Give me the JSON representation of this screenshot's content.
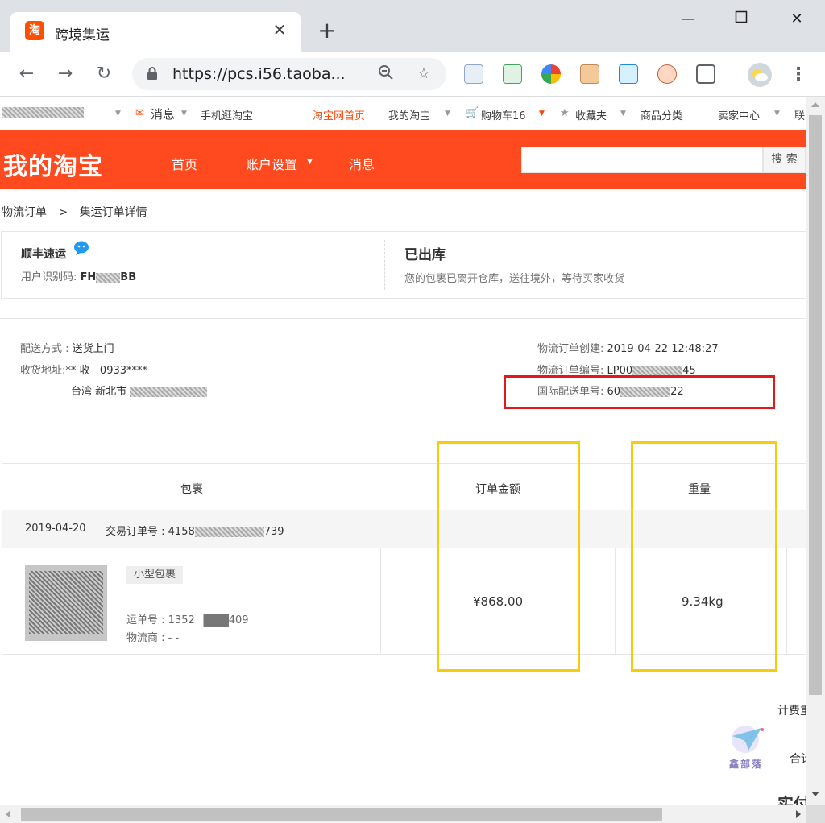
{
  "browser": {
    "tab_title": "跨境集运",
    "tab_favicon": "淘",
    "url": "https://pcs.i56.taoba...",
    "colors": {
      "chrome_bg": "#dee1e6",
      "tab_bg": "#ffffff"
    },
    "icons": [
      "back-icon",
      "forward-icon",
      "reload-icon",
      "lock-icon",
      "zoom-icon",
      "star-icon",
      "profile-avatar-icon",
      "menu-icon"
    ]
  },
  "site_bar": {
    "message": "消息",
    "mobile": "手机逛淘宝",
    "home": "淘宝网首页",
    "my_taobao": "我的淘宝",
    "cart": "购物车16",
    "favorites": "收藏夹",
    "categories": "商品分类",
    "seller": "卖家中心",
    "more": "联"
  },
  "header": {
    "brand": "我的淘宝",
    "nav": [
      "首页",
      "账户设置",
      "消息"
    ],
    "search_button": "搜 索",
    "brand_color": "#ff4a1f"
  },
  "breadcrumb": {
    "root": "物流订单",
    "sep": ">",
    "current": "集运订单详情"
  },
  "status_panel": {
    "carrier": "顺丰速运",
    "user_code_label": "用户识别码:",
    "user_code_prefix": "FH",
    "user_code_suffix": "BB",
    "status": "已出库",
    "status_desc": "您的包裹已离开仓库，送往境外，等待买家收货"
  },
  "info": {
    "delivery_label": "配送方式 :",
    "delivery_value": "送货上门",
    "address_label": "收货地址:",
    "address_line1": "** 收   0933****",
    "address_line2": "台湾 新北市",
    "created_label": "物流订单创建:",
    "created_value": "2019-04-22 12:48:27",
    "order_no_label": "物流订单编号:",
    "order_no_prefix": "LP00",
    "order_no_suffix": "45",
    "intl_no_label": "国际配送单号:",
    "intl_no_prefix": "60",
    "intl_no_suffix": "22"
  },
  "table": {
    "headers": {
      "package": "包裹",
      "amount": "订单金额",
      "weight": "重量"
    },
    "order_date": "2019-04-20",
    "trade_label": "交易订单号 :",
    "trade_prefix": "4158",
    "trade_suffix": "739",
    "item": {
      "tag": "小型包裹",
      "waybill_label": "运单号 :",
      "waybill_prefix": "1352",
      "waybill_suffix": "409",
      "logistics_label": "物流商 :",
      "logistics_value": "- -",
      "amount": "¥868.00",
      "weight": "9.34kg"
    }
  },
  "footer": {
    "fee_label": "计费重",
    "total_label": "合计",
    "actual_label": "实付"
  },
  "watermark": {
    "text": "鑫部落"
  },
  "annotations": {
    "red_box_color": "#e31818",
    "yellow_box_color": "#f5cd0a"
  }
}
